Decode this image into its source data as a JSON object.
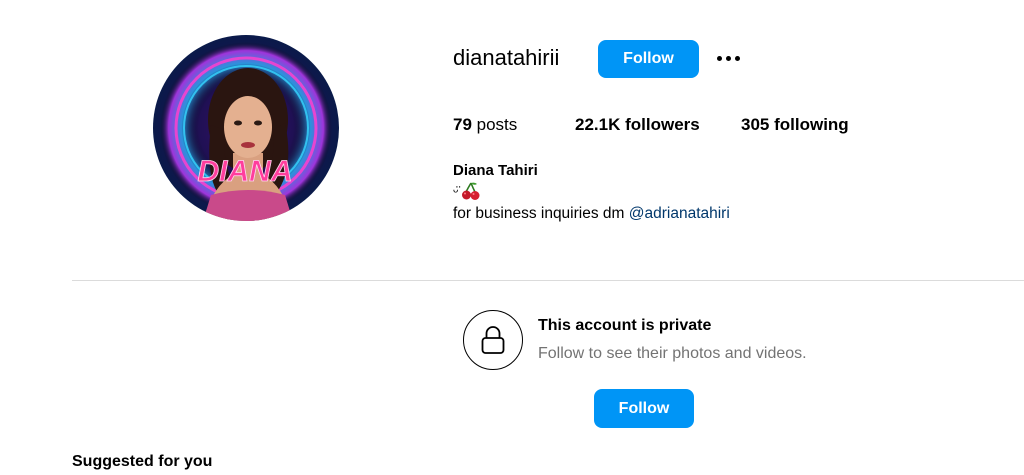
{
  "profile": {
    "username": "dianatahirii",
    "follow_label": "Follow",
    "avatar_text": "DIANA"
  },
  "stats": {
    "posts_count": "79",
    "posts_label": " posts",
    "followers_count": "22.1K",
    "followers_label": " followers",
    "following_count": "305",
    "following_label": " following"
  },
  "bio": {
    "full_name": "Diana Tahiri",
    "emoji_line": "ᵕ̈",
    "emoji_icon": "cherries-icon",
    "text": "for business inquiries dm ",
    "mention": "@adrianatahiri"
  },
  "private": {
    "title": "This account is private",
    "subtitle": "Follow to see their photos and videos.",
    "follow_label": "Follow",
    "icon": "lock-icon"
  },
  "suggested": {
    "heading": "Suggested for you"
  },
  "colors": {
    "accent": "#0095f6",
    "link": "#00376b",
    "muted": "#737373",
    "divider": "#dbdbdb"
  }
}
